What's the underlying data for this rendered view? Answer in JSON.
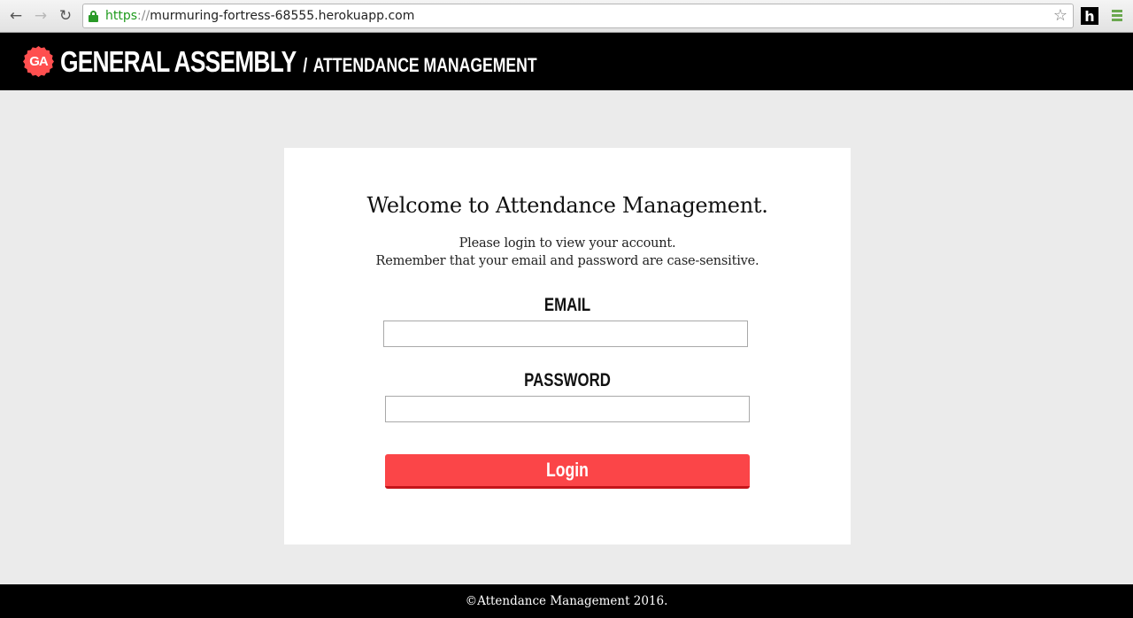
{
  "browser": {
    "url_scheme": "https",
    "url_sep": "://",
    "url_host": "murmuring-fortress-68555.herokuapp.com",
    "extension_label": "h",
    "icons": [
      "back-arrow-icon",
      "forward-arrow-icon",
      "reload-icon",
      "lock-icon",
      "bookmark-star-icon",
      "menu-icon"
    ]
  },
  "header": {
    "logo_text": "GA",
    "brand": "GENERAL ASSEMBLY",
    "slash": "/",
    "subtitle": "ATTENDANCE MANAGEMENT",
    "logo_color": "#ff4f4f"
  },
  "login": {
    "title": "Welcome to Attendance Management.",
    "line1": "Please login to view your account.",
    "line2": "Remember that your email and password are case-sensitive.",
    "email_label": "EMAIL",
    "email_value": "",
    "password_label": "PASSWORD",
    "password_value": "",
    "button_label": "Login",
    "button_color": "#fb4548"
  },
  "footer": {
    "text": "©Attendance Management 2016."
  }
}
